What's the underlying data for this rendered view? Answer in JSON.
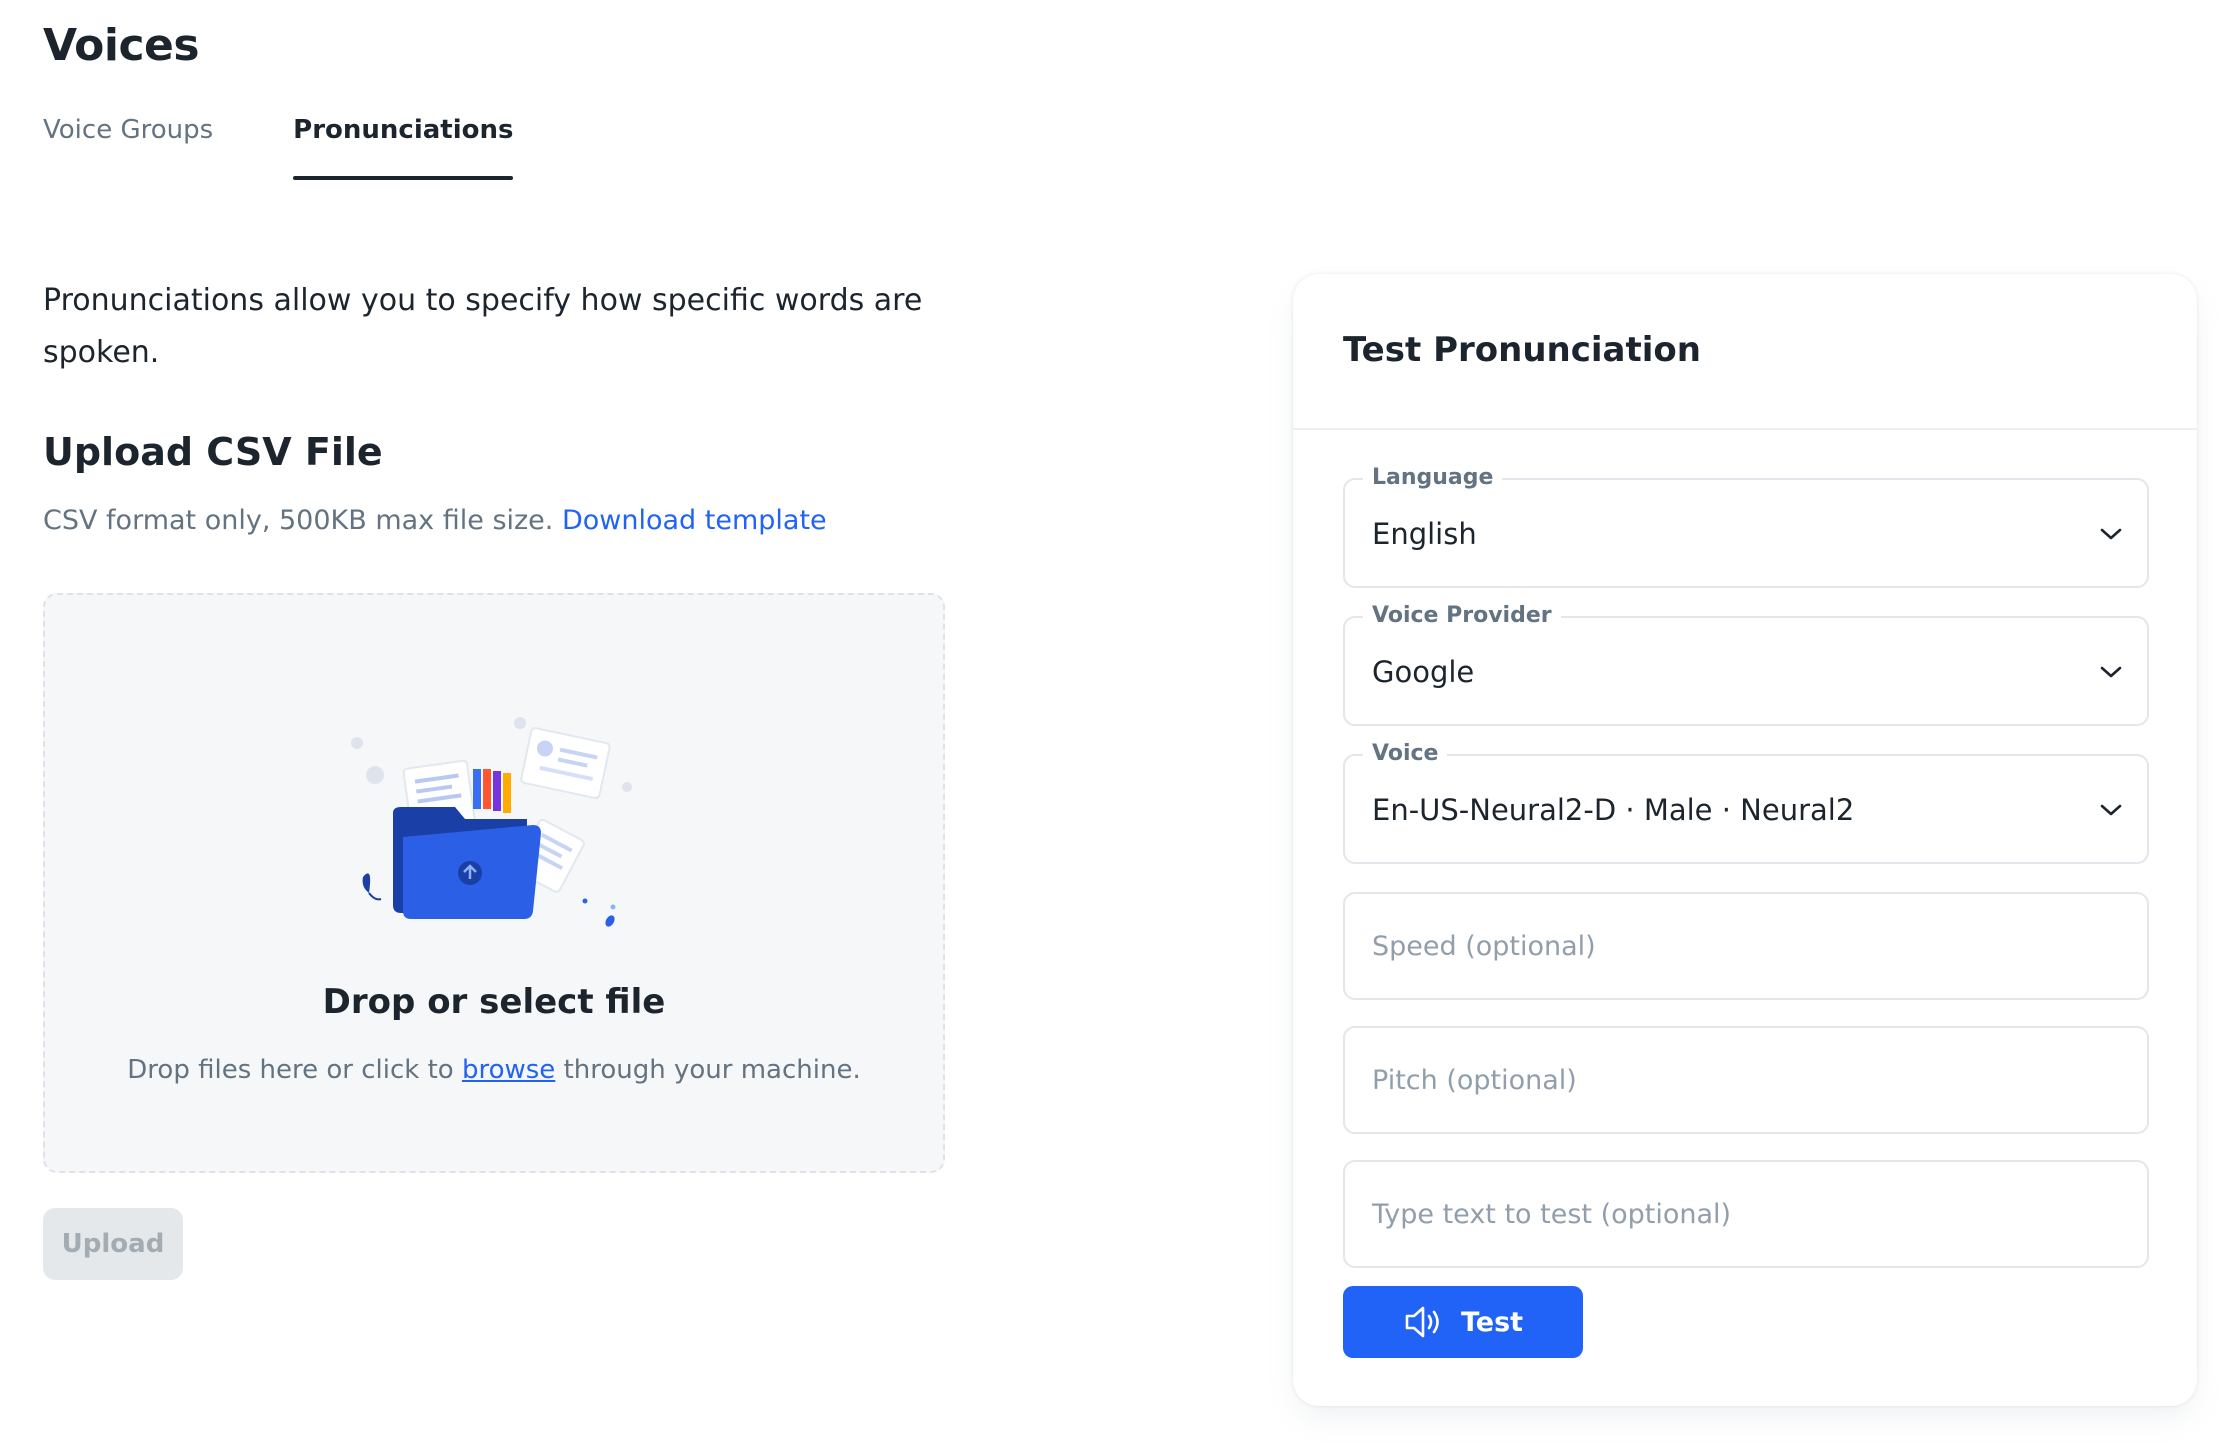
{
  "page": {
    "title": "Voices",
    "tabs": [
      {
        "label": "Voice Groups",
        "active": false
      },
      {
        "label": "Pronunciations",
        "active": true
      }
    ]
  },
  "intro": {
    "text": "Pronunciations allow you to specify how specific words are spoken."
  },
  "upload": {
    "heading": "Upload CSV File",
    "note": "CSV format only, 500KB max file size.",
    "template_link": "Download template",
    "dropzone": {
      "title": "Drop or select file",
      "sub_before": "Drop files here or click to",
      "sub_link": "browse",
      "sub_after": "through your machine.",
      "illustration": "folder-upload-illustration"
    },
    "button_label": "Upload",
    "button_disabled": true
  },
  "test_panel": {
    "title": "Test Pronunciation",
    "language": {
      "label": "Language",
      "value": "English"
    },
    "provider": {
      "label": "Voice Provider",
      "value": "Google"
    },
    "voice": {
      "label": "Voice",
      "value": "En-US-Neural2-D · Male · Neural2"
    },
    "speed": {
      "placeholder": "Speed (optional)",
      "value": ""
    },
    "pitch": {
      "placeholder": "Pitch (optional)",
      "value": ""
    },
    "text": {
      "placeholder": "Type text to test (optional)",
      "value": ""
    },
    "test_button": {
      "label": "Test",
      "icon": "speaker-icon"
    }
  },
  "colors": {
    "accent": "#2163f6",
    "text_primary": "#1c252e",
    "text_secondary": "#637381",
    "disabled_bg": "#e5e8eb"
  }
}
